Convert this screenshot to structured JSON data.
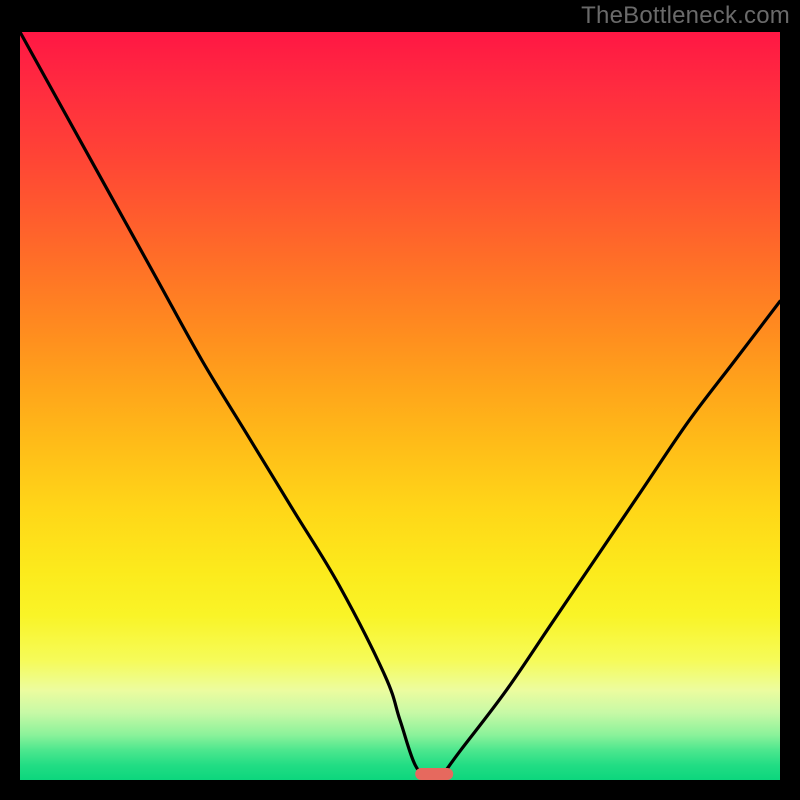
{
  "watermark": "TheBottleneck.com",
  "chart_data": {
    "type": "line",
    "title": "",
    "xlabel": "",
    "ylabel": "",
    "xlim": [
      0,
      100
    ],
    "ylim": [
      0,
      100
    ],
    "grid": false,
    "legend": false,
    "series": [
      {
        "name": "bottleneck-curve",
        "x": [
          0,
          6,
          12,
          18,
          24,
          30,
          36,
          42,
          48,
          50,
          52,
          54,
          55,
          58,
          64,
          70,
          76,
          82,
          88,
          94,
          100
        ],
        "values": [
          100,
          89,
          78,
          67,
          56,
          46,
          36,
          26,
          14,
          8,
          2,
          0,
          0,
          4,
          12,
          21,
          30,
          39,
          48,
          56,
          64
        ]
      }
    ],
    "optimal_marker": {
      "x": 54.5,
      "width": 5,
      "color": "#e6695e"
    },
    "background_gradient_stops": [
      {
        "pos": 0,
        "color": "#ff1744"
      },
      {
        "pos": 50,
        "color": "#ffbf18"
      },
      {
        "pos": 80,
        "color": "#f9f427"
      },
      {
        "pos": 100,
        "color": "#0cd67d"
      }
    ]
  }
}
